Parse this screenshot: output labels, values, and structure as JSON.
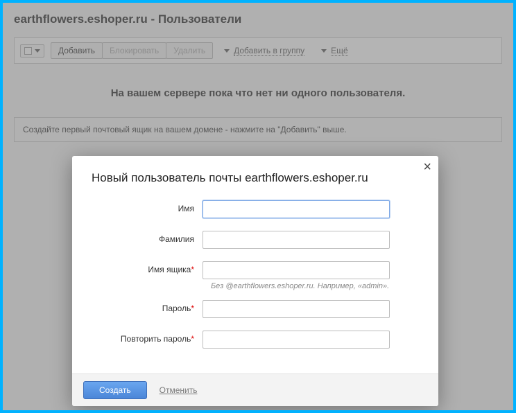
{
  "header": {
    "title": "earthflowers.eshoper.ru - Пользователи"
  },
  "toolbar": {
    "add": "Добавить",
    "block": "Блокировать",
    "delete": "Удалить",
    "add_to_group": "Добавить в группу",
    "more": "Ещё"
  },
  "main": {
    "empty_message": "На вашем сервере пока что нет ни одного пользователя.",
    "hint": "Создайте первый почтовый ящик на вашем домене - нажмите на \"Добавить\" выше."
  },
  "modal": {
    "title": "Новый пользователь почты earthflowers.eshoper.ru",
    "fields": {
      "first_name": {
        "label": "Имя",
        "value": ""
      },
      "last_name": {
        "label": "Фамилия",
        "value": ""
      },
      "mailbox": {
        "label": "Имя ящика",
        "value": "",
        "helper": "Без @earthflowers.eshoper.ru. Например, «admin»."
      },
      "password": {
        "label": "Пароль",
        "value": ""
      },
      "password_repeat": {
        "label": "Повторить пароль",
        "value": ""
      }
    },
    "buttons": {
      "create": "Создать",
      "cancel": "Отменить"
    }
  }
}
